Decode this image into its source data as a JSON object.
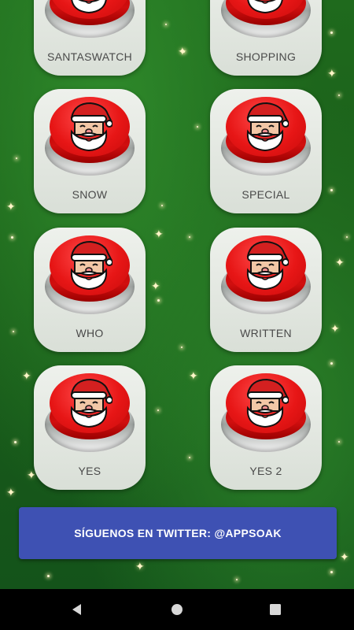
{
  "buttons": [
    {
      "label": "SANTASWATCH",
      "icon": "santa-icon"
    },
    {
      "label": "SHOPPING",
      "icon": "santa-icon"
    },
    {
      "label": "SNOW",
      "icon": "santa-icon"
    },
    {
      "label": "SPECIAL",
      "icon": "santa-icon"
    },
    {
      "label": "WHO",
      "icon": "santa-icon"
    },
    {
      "label": "WRITTEN",
      "icon": "santa-icon"
    },
    {
      "label": "YES",
      "icon": "santa-icon"
    },
    {
      "label": "YES 2",
      "icon": "santa-icon"
    }
  ],
  "follow_button": {
    "label": "SÍGUENOS EN TWITTER: @APPSOAK"
  },
  "colors": {
    "background": "#1f6a1d",
    "card": "#e3e8e1",
    "button_red": "#e71616",
    "follow_button": "#3e51b3",
    "navbar": "#000000"
  },
  "navbar": {
    "back_icon": "back-triangle-icon",
    "home_icon": "home-circle-icon",
    "recents_icon": "recents-square-icon"
  }
}
